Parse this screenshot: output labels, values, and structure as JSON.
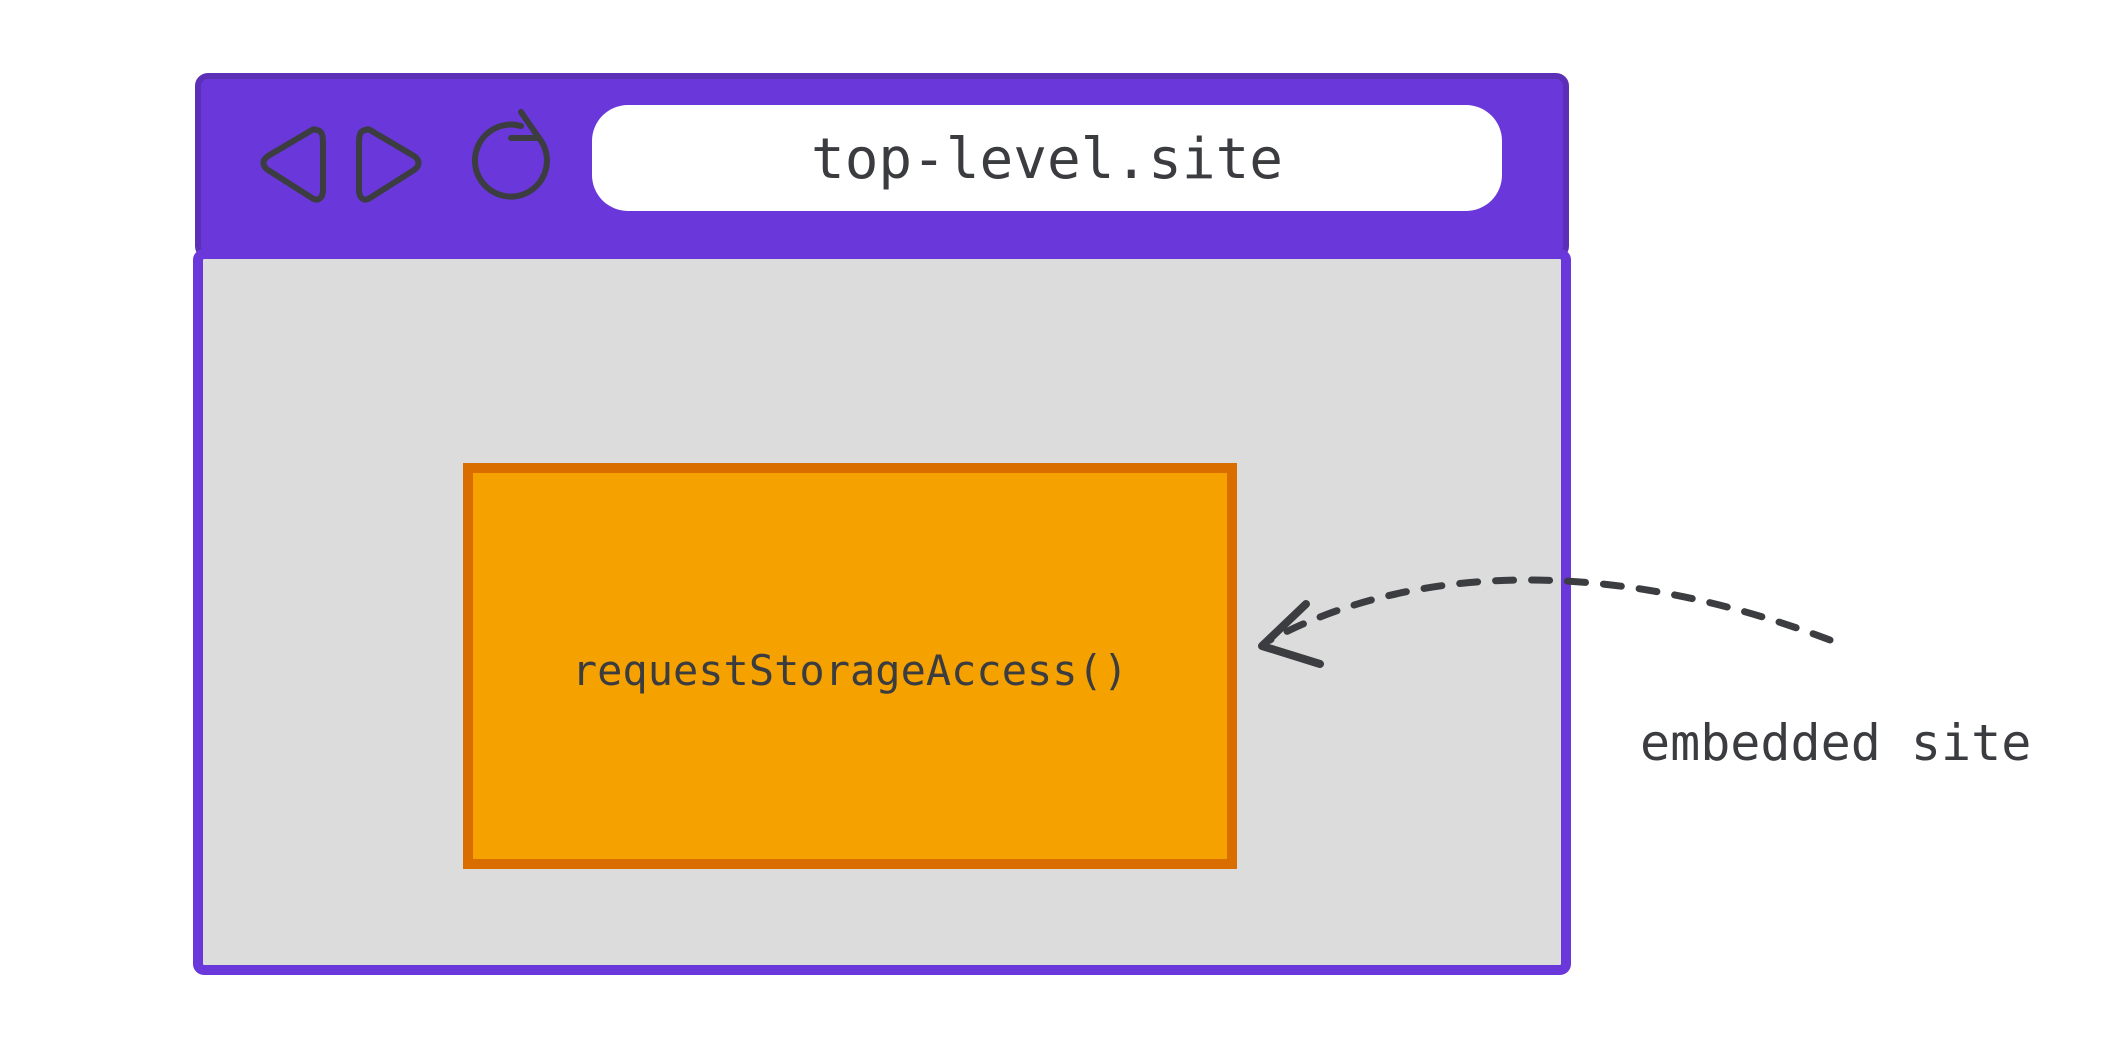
{
  "address_bar": {
    "url": "top-level.site"
  },
  "embedded_frame": {
    "code": "requestStorageAccess()"
  },
  "annotation": {
    "label": "embedded site"
  },
  "colors": {
    "browser_purple": "#6a37da",
    "browser_border": "#5b30b6",
    "page_grey": "#dcdcdc",
    "page_border": "#6a37da",
    "embed_fill": "#f5a200",
    "embed_border": "#da6d00",
    "stroke_dark": "#3c3d41",
    "address_bg": "#ffffff"
  }
}
